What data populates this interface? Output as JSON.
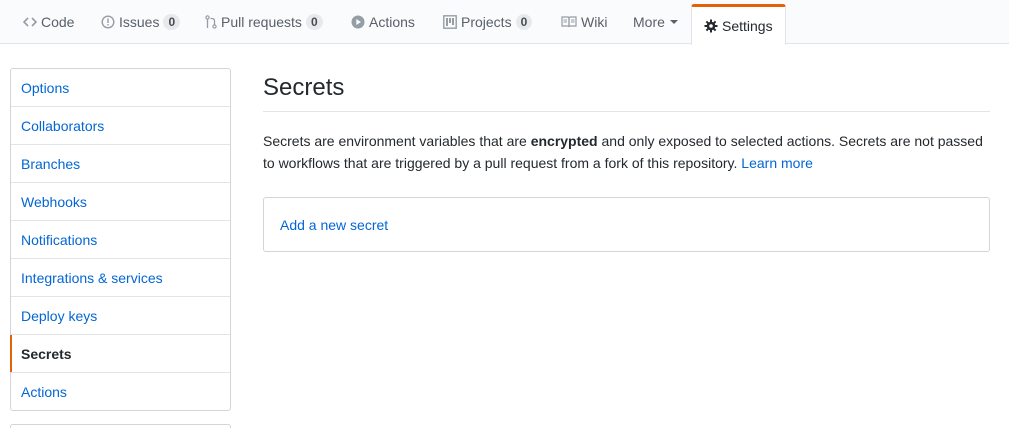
{
  "tabs": [
    {
      "label": "Code",
      "icon": "code-icon"
    },
    {
      "label": "Issues",
      "icon": "issue-opened-icon",
      "count": "0"
    },
    {
      "label": "Pull requests",
      "icon": "git-pull-request-icon",
      "count": "0"
    },
    {
      "label": "Actions",
      "icon": "play-icon"
    },
    {
      "label": "Projects",
      "icon": "project-icon",
      "count": "0"
    },
    {
      "label": "Wiki",
      "icon": "book-icon"
    },
    {
      "label": "More",
      "icon": "chevron-down-icon"
    },
    {
      "label": "Settings",
      "icon": "gear-icon",
      "selected": true
    }
  ],
  "sidebar": {
    "items": [
      {
        "label": "Options"
      },
      {
        "label": "Collaborators"
      },
      {
        "label": "Branches"
      },
      {
        "label": "Webhooks"
      },
      {
        "label": "Notifications"
      },
      {
        "label": "Integrations & services"
      },
      {
        "label": "Deploy keys"
      },
      {
        "label": "Secrets",
        "selected": true
      },
      {
        "label": "Actions"
      }
    ]
  },
  "main": {
    "title": "Secrets",
    "description": {
      "before": "Secrets are environment variables that are ",
      "bold": "encrypted",
      "after": " and only exposed to selected actions. Secrets are not passed to workflows that are triggered by a pull request from a fork of this repository. ",
      "link": "Learn more"
    },
    "add_secret_link": "Add a new secret"
  },
  "colors": {
    "accent": "#e36209",
    "link": "#0366d6",
    "text": "#24292e",
    "muted": "#586069"
  }
}
